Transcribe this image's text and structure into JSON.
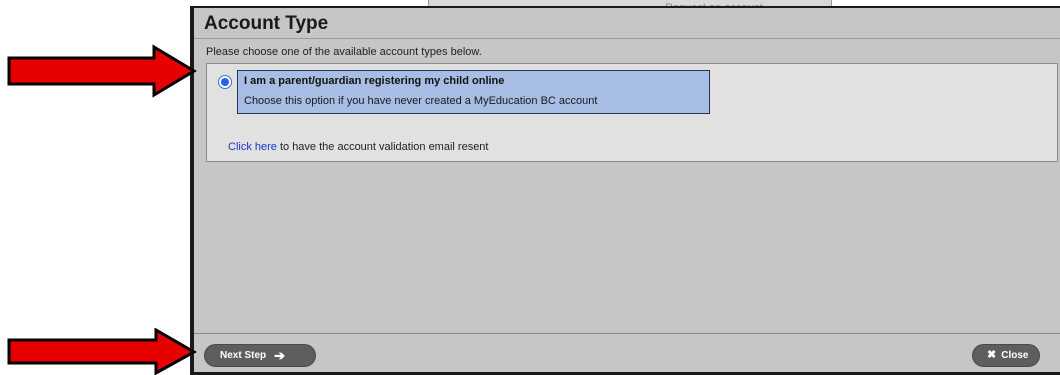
{
  "background": {
    "partial_text": "Request an account"
  },
  "dialog": {
    "title": "Account Type",
    "instruction": "Please choose one of the available account types below.",
    "option": {
      "title": "I am a parent/guardian registering my child online",
      "description": "Choose this option if you have never created a MyEducation BC account",
      "selected": true
    },
    "resend": {
      "link": "Click here",
      "rest": " to have the account validation email resent"
    },
    "buttons": {
      "next": "Next Step",
      "close": "Close"
    }
  },
  "icons": {
    "next": "arrow-right-icon",
    "close": "x-icon",
    "annotations": "red-arrow"
  },
  "colors": {
    "selection": "#a7bde3",
    "link": "#1d35c9",
    "annotation_arrow": "#e60000"
  }
}
